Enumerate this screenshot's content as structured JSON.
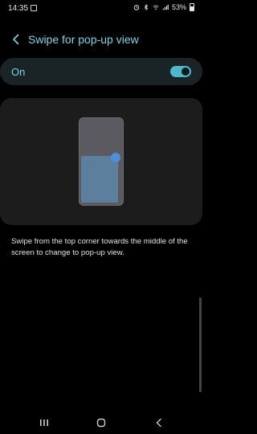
{
  "status_bar": {
    "time": "14:35",
    "battery_percent": "53%"
  },
  "header": {
    "title": "Swipe for pop-up view"
  },
  "toggle": {
    "label": "On",
    "state": true
  },
  "description": "Swipe from the top corner towards the middle of the screen to change to pop-up view.",
  "colors": {
    "accent": "#7fd4e6",
    "switch_on": "#4fb8cc",
    "gesture_dot": "#4d8fd9",
    "popup": "#5d7f9e"
  }
}
